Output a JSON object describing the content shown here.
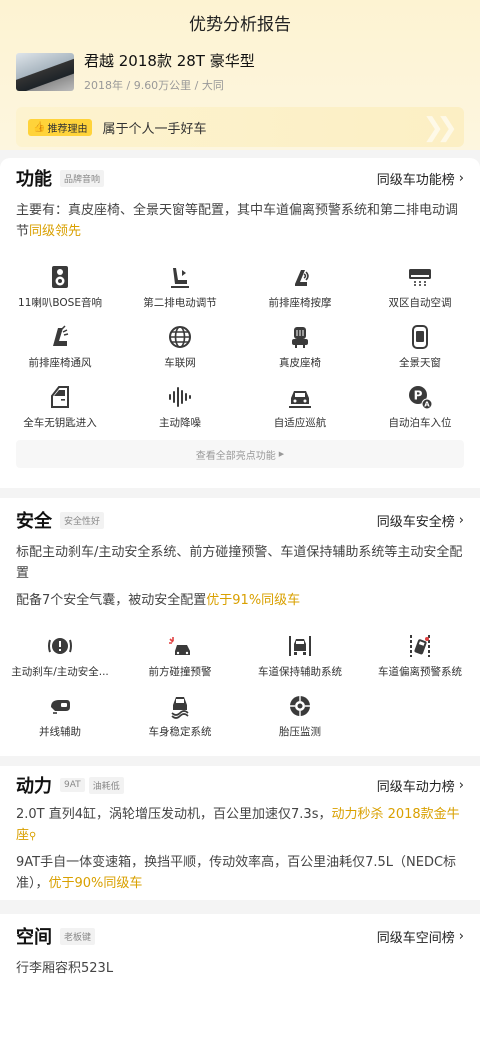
{
  "header": {
    "title": "优势分析报告"
  },
  "car": {
    "name": "君越 2018款 28T 豪华型",
    "meta": "2018年 / 9.60万公里 / 大同"
  },
  "reason": {
    "tag": "推荐理由",
    "text": "属于个人一手好车"
  },
  "function": {
    "title": "功能",
    "tags": [
      "品牌音响"
    ],
    "rank": "同级车功能榜",
    "desc_main": "主要有：真皮座椅、全景天窗等配置，其中车道偏离预警系统和第二排电动调节",
    "desc_hl": "同级领先",
    "items": [
      {
        "label": "11喇叭BOSE音响",
        "icon": "speaker-icon"
      },
      {
        "label": "第二排电动调节",
        "icon": "seat-adjust-icon"
      },
      {
        "label": "前排座椅按摩",
        "icon": "seat-massage-icon"
      },
      {
        "label": "双区自动空调",
        "icon": "ac-icon"
      },
      {
        "label": "前排座椅通风",
        "icon": "seat-ventilation-icon"
      },
      {
        "label": "车联网",
        "icon": "globe-icon"
      },
      {
        "label": "真皮座椅",
        "icon": "leather-seat-icon"
      },
      {
        "label": "全景天窗",
        "icon": "sunroof-icon"
      },
      {
        "label": "全车无钥匙进入",
        "icon": "car-door-icon"
      },
      {
        "label": "主动降噪",
        "icon": "sound-wave-icon"
      },
      {
        "label": "自适应巡航",
        "icon": "cruise-icon"
      },
      {
        "label": "自动泊车入位",
        "icon": "parking-icon"
      }
    ],
    "view_all": "查看全部亮点功能"
  },
  "safety": {
    "title": "安全",
    "tags": [
      "安全性好"
    ],
    "rank": "同级车安全榜",
    "desc1": "标配主动刹车/主动安全系统、前方碰撞预警、车道保持辅助系统等主动安全配置",
    "desc2_main": "配备7个安全气囊，被动安全配置",
    "desc2_hl": "优于91%同级车",
    "items": [
      {
        "label": "主动刹车/主动安全...",
        "icon": "brake-warning-icon"
      },
      {
        "label": "前方碰撞预警",
        "icon": "collision-warning-icon"
      },
      {
        "label": "车道保持辅助系统",
        "icon": "lane-keep-icon"
      },
      {
        "label": "车道偏离预警系统",
        "icon": "lane-departure-icon"
      },
      {
        "label": "并线辅助",
        "icon": "blind-spot-icon"
      },
      {
        "label": "车身稳定系统",
        "icon": "stability-icon"
      },
      {
        "label": "胎压监测",
        "icon": "tire-pressure-icon"
      }
    ]
  },
  "power": {
    "title": "动力",
    "tags": [
      "9AT",
      "油耗低"
    ],
    "rank": "同级车动力榜",
    "desc1_main": "2.0T 直列4缸，涡轮增压发动机，百公里加速仅7.3s，",
    "desc1_hl": "动力秒杀 2018款金牛座",
    "desc2_main": "9AT手自一体变速箱，换挡平顺，传动效率高，百公里油耗仅7.5L（NEDC标准），",
    "desc2_hl": "优于90%同级车"
  },
  "space": {
    "title": "空间",
    "tags": [
      "老板键"
    ],
    "rank": "同级车空间榜",
    "desc": "行李厢容积523L"
  },
  "colors": {
    "accent": "#d9a000",
    "tag_yellow": "#ffd33a",
    "bg": "#f4f4f4"
  }
}
